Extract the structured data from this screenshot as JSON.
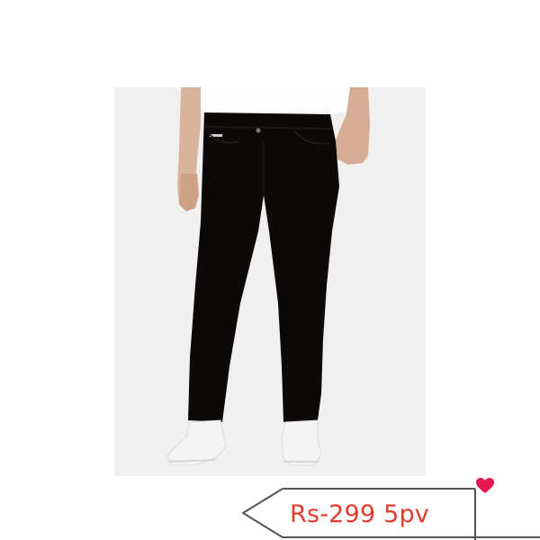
{
  "product": {
    "image_subject": "black-jeans-model-photo",
    "background_color": "#f0f0f0",
    "jeans_color": "#0c0908",
    "shirt_color": "#ffffff",
    "sneaker_color": "#f4f4f4"
  },
  "price_tag": {
    "label": "Rs-299 5pv",
    "text_color": "#e23b2d",
    "outline_color": "#555555",
    "heart_icon": "heart-icon",
    "heart_color": "#e8174f"
  }
}
